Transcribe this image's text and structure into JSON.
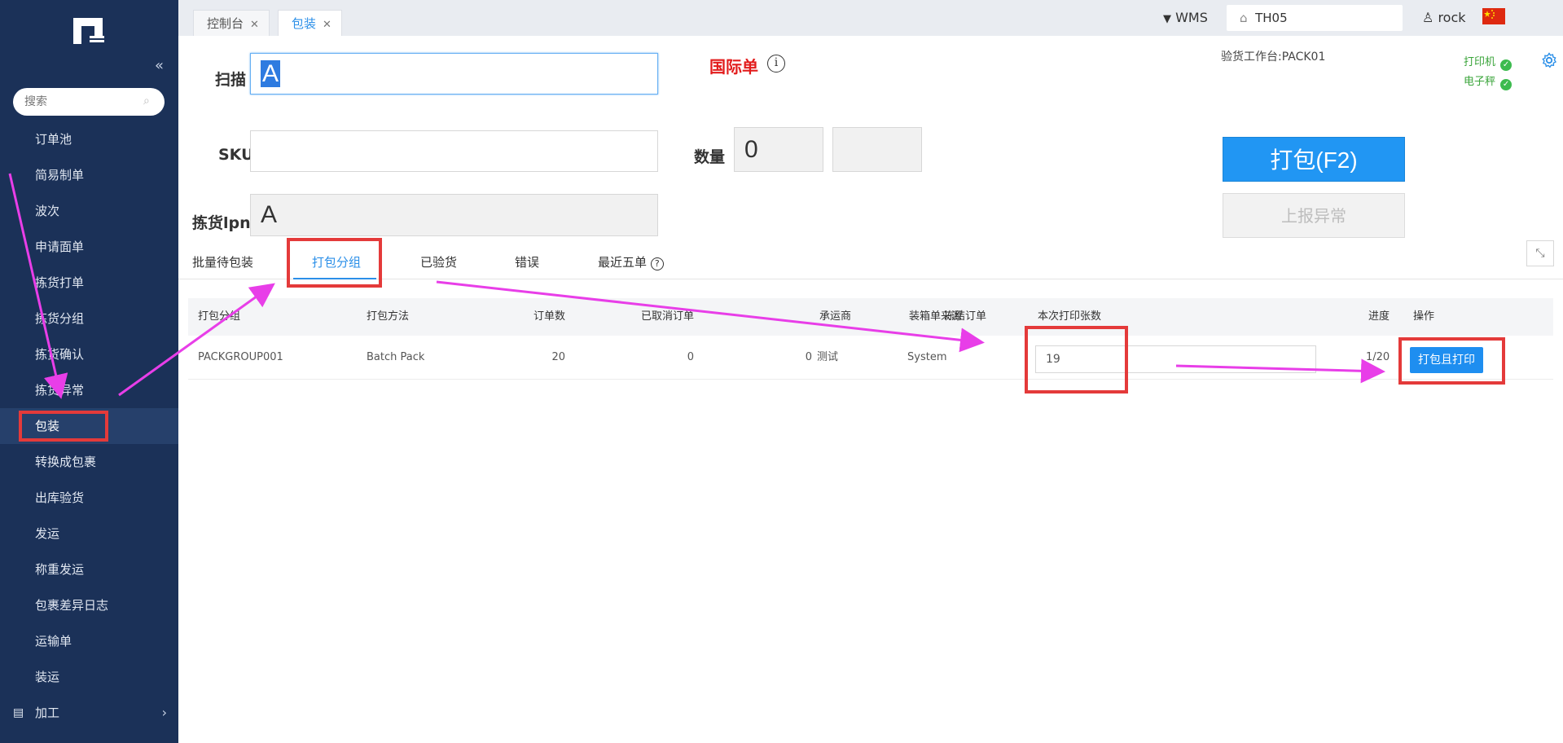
{
  "sidebar": {
    "search_placeholder": "搜索",
    "items": [
      {
        "label": "订单池"
      },
      {
        "label": "简易制单"
      },
      {
        "label": "波次"
      },
      {
        "label": "申请面单"
      },
      {
        "label": "拣货打单"
      },
      {
        "label": "拣货分组"
      },
      {
        "label": "拣货确认"
      },
      {
        "label": "拣货异常"
      },
      {
        "label": "包装"
      },
      {
        "label": "转换成包裹"
      },
      {
        "label": "出库验货"
      },
      {
        "label": "发运"
      },
      {
        "label": "称重发运"
      },
      {
        "label": "包裹差异日志"
      },
      {
        "label": "运输单"
      },
      {
        "label": "装运"
      },
      {
        "label": "加工"
      }
    ]
  },
  "topbar": {
    "tabs": [
      {
        "label": "控制台"
      },
      {
        "label": "包装"
      }
    ],
    "system": "WMS",
    "warehouse": "TH05",
    "user": "rock"
  },
  "form": {
    "scan_label": "扫描",
    "scan_value": "A",
    "order_type": "国际单",
    "sku_label": "SKU",
    "qty_label": "数量",
    "qty_value": "0",
    "lpn_label": "拣货lpn",
    "lpn_value": "A"
  },
  "workstation": "验货工作台:PACK01",
  "status": {
    "printer": "打印机",
    "scale": "电子秤"
  },
  "buttons": {
    "pack": "打包(F2)",
    "report": "上报异常",
    "pack_print": "打包且打印"
  },
  "subtabs": [
    {
      "label": "批量待包装"
    },
    {
      "label": "打包分组"
    },
    {
      "label": "已验货"
    },
    {
      "label": "错误"
    },
    {
      "label": "最近五单"
    }
  ],
  "table": {
    "headers": [
      "打包分组",
      "打包方法",
      "订单数",
      "已取消订单",
      "冻结订单",
      "承运商",
      "装箱单来源",
      "本次打印张数",
      "进度",
      "操作"
    ],
    "row": {
      "group": "PACKGROUP001",
      "method": "Batch Pack",
      "orders": "20",
      "cancelled": "0",
      "frozen": "0",
      "carrier": "测试",
      "source": "System",
      "print_count": "19",
      "progress": "1/20"
    }
  },
  "colors": {
    "sidebar": "#1b3158",
    "accent": "#2196f3",
    "highlight": "#e43a3a",
    "arrow": "#e83ee8"
  }
}
